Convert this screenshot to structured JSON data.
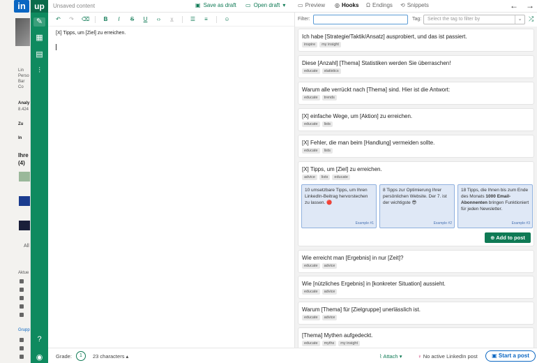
{
  "background_linkedin": {
    "logo": "in",
    "profile_snippet": [
      "Lin",
      "Perso",
      "Bar",
      "Co"
    ],
    "analytics_title": "Analy",
    "analytics_count": "8.424",
    "link1": "Zu",
    "link2": "In",
    "section_title": "Ihre",
    "section_count": "(4)",
    "all_label": "All",
    "activity_label": "Aktue",
    "group_label": "Grupp"
  },
  "app": {
    "logo": "up",
    "title": "Unsaved content",
    "save_draft": "Save as draft",
    "open_draft": "Open draft",
    "tabs": [
      "Preview",
      "Hooks",
      "Endings",
      "Snippets"
    ],
    "active_tab": "Hooks"
  },
  "editor": {
    "content": "[X] Tipps, um [Ziel] zu erreichen."
  },
  "filter": {
    "filter_label": "Filter:",
    "filter_value": "",
    "tag_label": "Tag:",
    "tag_placeholder": "Select the tag to filter by"
  },
  "hooks": [
    {
      "text": "Ich habe [Strategie/Taktik/Ansatz] ausprobiert, und das ist passiert.",
      "tags": [
        "inspire",
        "my insight"
      ]
    },
    {
      "text": "Diese [Anzahl] [Thema] Statistiken werden Sie überraschen!",
      "tags": [
        "educate",
        "statistics"
      ]
    },
    {
      "text": "Warum alle verrückt nach [Thema] sind. Hier ist die Antwort:",
      "tags": [
        "educate",
        "trends"
      ]
    },
    {
      "text": "[X] einfache Wege, um [Aktion] zu erreichen.",
      "tags": [
        "educate",
        "lists"
      ]
    },
    {
      "text": "[X] Fehler, die man beim [Handlung] vermeiden sollte.",
      "tags": [
        "educate",
        "lists"
      ]
    },
    {
      "text": "[X] Tipps, um [Ziel] zu erreichen.",
      "tags": [
        "advice",
        "lists",
        "educate"
      ]
    },
    {
      "text": "Wie erreicht man [Ergebnis] in nur [Zeit]?",
      "tags": [
        "educate",
        "advice"
      ]
    },
    {
      "text": "Wie [nützliches Ergebnis] in [konkreter Situation] aussieht.",
      "tags": [
        "educate",
        "advice"
      ]
    },
    {
      "text": "Warum [Thema] für [Zielgruppe] unerlässlich ist.",
      "tags": [
        "educate",
        "advice"
      ]
    },
    {
      "text": "[Thema] Mythen aufgedeckt.",
      "tags": [
        "educate",
        "myths",
        "my insight"
      ]
    }
  ],
  "examples": [
    {
      "label": "Example #1",
      "pre": "10 umsetzbare Tipps, um Ihren LinkedIn-Beitrag hervorstechen zu lassen. ",
      "bold": "",
      "post": "",
      "emoji": "🔴"
    },
    {
      "label": "Example #2",
      "pre": "8 Tipps zur Optimierung Ihrer persönlichen Website. Der 7. ist der wichtigste ",
      "bold": "",
      "post": "",
      "emoji": "😎"
    },
    {
      "label": "Example #3",
      "pre": "18 Tipps, die Ihnen bis zum Ende des Monats ",
      "bold": "1000 Email-Abonnenten",
      "post": " bringen Funktioniert für jeden Newsletter.",
      "emoji": ""
    }
  ],
  "add_to_post": "Add to post",
  "footer": {
    "grade_label": "Grade:",
    "grade_value": "1",
    "char_count": "23 characters",
    "attach": "Attach",
    "no_post": "No active LinkedIn post",
    "start_post": "Start a post"
  },
  "colors": {
    "brand_green": "#0f8a5f",
    "linkedin_blue": "#0a66c2"
  }
}
